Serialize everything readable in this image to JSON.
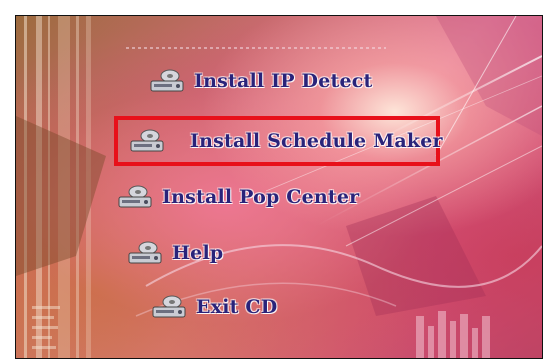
{
  "menu": {
    "items": [
      {
        "label": "Install IP Detect",
        "icon": "install-icon"
      },
      {
        "label": "Install Schedule Maker",
        "icon": "install-icon"
      },
      {
        "label": "Install Pop Center",
        "icon": "install-icon"
      },
      {
        "label": "Help",
        "icon": "help-icon"
      },
      {
        "label": "Exit CD",
        "icon": "exit-icon"
      }
    ],
    "selected_index": 1
  },
  "colors": {
    "label_text": "#2a237a",
    "highlight_border": "#e8101a"
  }
}
